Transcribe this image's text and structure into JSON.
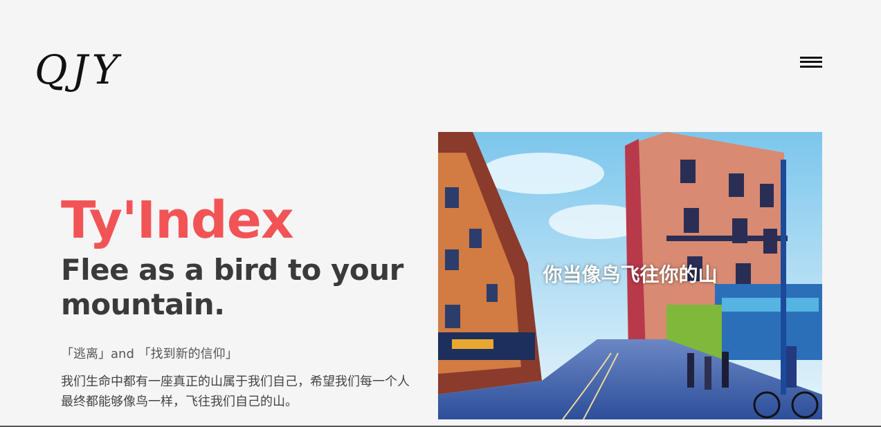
{
  "header": {
    "logo_text": "QJY",
    "menu_icon": "hamburger-menu-icon"
  },
  "hero": {
    "title": "Ty'Index",
    "tagline": "Flee as a bird to your mountain.",
    "subtitle": "「逃离」and 「找到新的信仰」",
    "description": "我们生命中都有一座真正的山属于我们自己，希望我们每一个人最终都能够像鸟一样，飞往我们自己的山。",
    "image_caption": "你当像鸟飞往你的山"
  },
  "colors": {
    "accent": "#f25456",
    "background": "#f5f5f5",
    "text": "#3a3a3a"
  }
}
